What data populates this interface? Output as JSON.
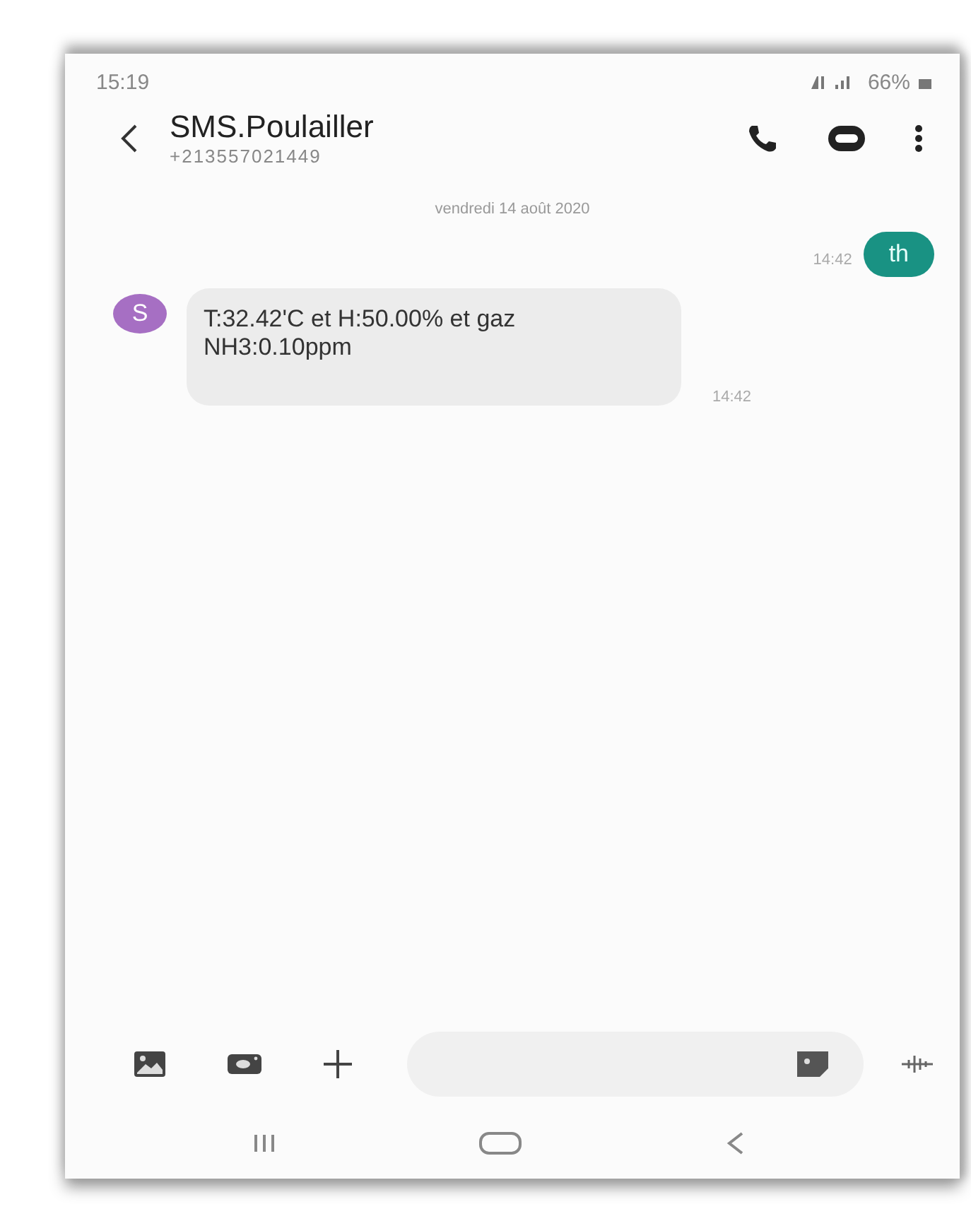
{
  "status_bar": {
    "time": "15:19",
    "battery": "66%"
  },
  "header": {
    "title": "SMS.Poulailler",
    "subtitle": "+213557021449"
  },
  "date": "vendredi 14 août 2020",
  "messages": [
    {
      "kind": "sent",
      "text": "th",
      "time": "14:42"
    },
    {
      "kind": "received",
      "avatar": "S",
      "color": "#a66fc3",
      "text": "T:32.42'C et H:50.00% et gaz NH3:0.10ppm",
      "time": "14:42"
    }
  ]
}
